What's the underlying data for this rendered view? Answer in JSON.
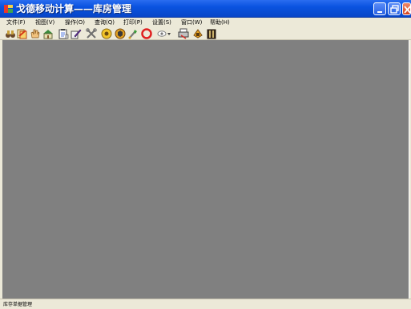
{
  "window": {
    "title": "戈德移动计算——库房管理",
    "icon": "app-logo-icon",
    "controls": [
      {
        "name": "minimize",
        "icon": "minimize-icon"
      },
      {
        "name": "maximize",
        "icon": "maximize-icon"
      },
      {
        "name": "close",
        "icon": "close-icon"
      }
    ]
  },
  "menubar": {
    "items": [
      "文件(F)",
      "视图(V)",
      "操作(O)",
      "查询(Q)",
      "打印(P)",
      "设置(S)",
      "窗口(W)",
      "帮助(H)"
    ]
  },
  "toolbar": {
    "buttons": [
      {
        "icon": "binoculars-icon"
      },
      {
        "icon": "document-stack-icon"
      },
      {
        "icon": "hand-icon"
      },
      {
        "icon": "warehouse-icon"
      },
      {
        "icon": "clipboard-icon"
      },
      {
        "icon": "edit-pen-icon"
      },
      {
        "icon": "tools-icon"
      },
      {
        "icon": "gear-icon"
      },
      {
        "icon": "box-icon"
      },
      {
        "icon": "wrench-icon"
      },
      {
        "icon": "stop-icon"
      },
      {
        "icon": "eye-dropdown-icon"
      },
      {
        "icon": "print-icon"
      },
      {
        "icon": "settings-icon"
      },
      {
        "icon": "exit-icon"
      }
    ]
  },
  "colors": {
    "titlebar": "#0a53e0",
    "workspace": "#808080",
    "chrome": "#ece9d8"
  },
  "statusbar": {
    "text": "库存单据管理"
  }
}
